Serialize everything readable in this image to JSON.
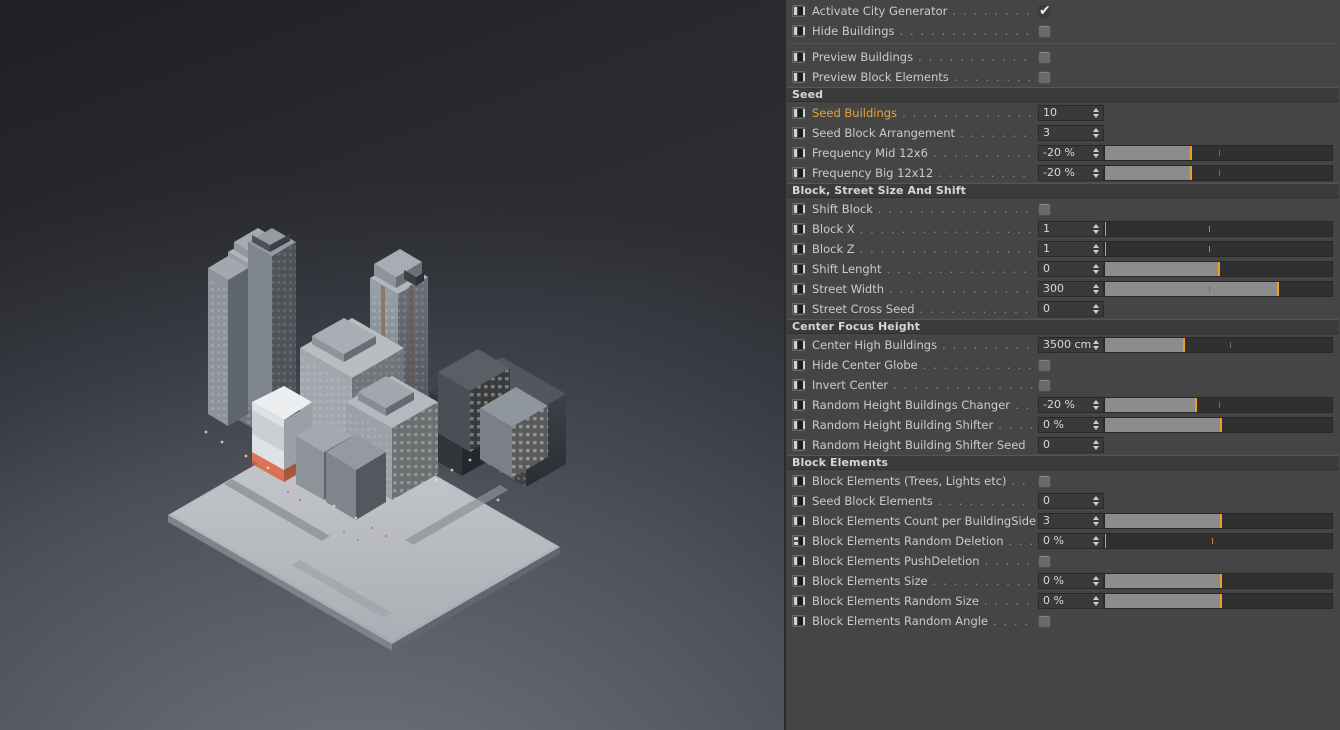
{
  "app": {
    "theme_bg": "#454545",
    "accent": "#f0a020",
    "highlight_text": "#e8a33d"
  },
  "viewport": {
    "name": "3d-viewport",
    "scene": "isometric city block with skyscrapers"
  },
  "panel": {
    "groups": [
      {
        "header": null,
        "rows": [
          {
            "label": "Activate City Generator",
            "dots": ". . . . . . . . . . . . . .",
            "type": "checkbox",
            "checked": true,
            "highlight": false,
            "icon": "port-icon"
          },
          {
            "label": "Hide Buildings",
            "dots": ". . . . . . . . . . . . . . . . . . .",
            "type": "checkbox",
            "checked": false,
            "highlight": false,
            "icon": "port-icon"
          }
        ]
      },
      {
        "header": null,
        "divider": true,
        "rows": [
          {
            "label": "Preview Buildings",
            "dots": ". . . . . . . . . . . . . . . . .",
            "type": "checkbox",
            "checked": false,
            "highlight": false,
            "icon": "port-icon"
          },
          {
            "label": "Preview Block Elements",
            "dots": ". . . . . . . . . . . .",
            "type": "checkbox",
            "checked": false,
            "highlight": false,
            "icon": "port-icon"
          }
        ]
      },
      {
        "header": "Seed",
        "rows": [
          {
            "label": "Seed Buildings",
            "dots": ". . . . . . . . . . . . . . . . . . .",
            "type": "number",
            "value": "10",
            "highlight": true,
            "icon": "port-icon"
          },
          {
            "label": "Seed Block Arrangement",
            "dots": ". . . . . . . . . . . . .",
            "type": "number",
            "value": "3",
            "highlight": false,
            "icon": "port-icon"
          },
          {
            "label": "Frequency Mid 12x6",
            "dots": ". . . . . . . . . . . . . . .",
            "type": "slider",
            "value": "-20 %",
            "fill": 38,
            "knob": 38,
            "tick": 50,
            "highlight": false,
            "icon": "port-icon"
          },
          {
            "label": "Frequency Big 12x12",
            "dots": ". . . . . . . . . . . . . .",
            "type": "slider",
            "value": "-20 %",
            "fill": 38,
            "knob": 38,
            "tick": 50,
            "highlight": false,
            "icon": "port-icon"
          }
        ]
      },
      {
        "header": "Block, Street Size And Shift",
        "rows": [
          {
            "label": "Shift Block",
            "dots": ". . . . . . . . . . . . . . . . . . . . .",
            "type": "checkbox",
            "checked": false,
            "highlight": false,
            "icon": "port-icon"
          },
          {
            "label": "Block X",
            "dots": ". . . . . . . . . . . . . . . . . . . . . . . .",
            "type": "slider",
            "value": "1",
            "fill": 0,
            "knob": 0,
            "tick": 46,
            "highlight": false,
            "icon": "port-icon"
          },
          {
            "label": "Block Z",
            "dots": ". . . . . . . . . . . . . . . . . . . . . . . .",
            "type": "slider",
            "value": "1",
            "fill": 0,
            "knob": 0,
            "tick": 46,
            "highlight": false,
            "icon": "port-icon"
          },
          {
            "label": "Shift Lenght",
            "dots": ". . . . . . . . . . . . . . . . . . . .",
            "type": "slider",
            "value": "0",
            "fill": 50,
            "knob": 50,
            "tick": -1,
            "highlight": false,
            "icon": "port-icon"
          },
          {
            "label": "Street Width",
            "dots": ". . . . . . . . . . . . . . . . . . . .",
            "type": "slider",
            "value": "300",
            "fill": 76,
            "knob": 76,
            "tick": 46,
            "highlight": false,
            "icon": "port-icon"
          },
          {
            "label": "Street Cross Seed",
            "dots": ". . . . . . . . . . . . . . . . .",
            "type": "number",
            "value": "0",
            "highlight": false,
            "icon": "port-icon"
          }
        ]
      },
      {
        "header": "Center Focus Height",
        "rows": [
          {
            "label": "Center High Buildings",
            "dots": ". . . . . . . . . . . . . .",
            "type": "slider",
            "value": "3500 cm",
            "fill": 35,
            "knob": 35,
            "tick": 55,
            "highlight": false,
            "icon": "port-icon"
          },
          {
            "label": "Hide Center Globe",
            "dots": ". . . . . . . . . . . . . . . .",
            "type": "checkbox",
            "checked": false,
            "highlight": false,
            "icon": "port-icon"
          },
          {
            "label": "Invert Center",
            "dots": ". . . . . . . . . . . . . . . . . . .",
            "type": "checkbox",
            "checked": false,
            "highlight": false,
            "icon": "port-icon"
          },
          {
            "label": "Random Height Buildings Changer",
            "dots": ". . . .",
            "type": "slider",
            "value": "-20 %",
            "fill": 40,
            "knob": 40,
            "tick": 50,
            "highlight": false,
            "icon": "port-icon"
          },
          {
            "label": "Random Height Building Shifter",
            "dots": ". . . . . .",
            "type": "slider",
            "value": "0 %",
            "fill": 51,
            "knob": 51,
            "tick": -1,
            "highlight": false,
            "icon": "port-icon"
          },
          {
            "label": "Random Height Building Shifter Seed",
            "dots": "",
            "type": "number",
            "value": "0",
            "highlight": false,
            "icon": "port-icon"
          }
        ]
      },
      {
        "header": "Block Elements",
        "rows": [
          {
            "label": "Block Elements (Trees, Lights etc)",
            "dots": ". . . . . .",
            "type": "checkbox",
            "checked": false,
            "highlight": false,
            "icon": "port-icon"
          },
          {
            "label": "Seed Block Elements",
            "dots": ". . . . . . . . . . . . . . .",
            "type": "number",
            "value": "0",
            "highlight": false,
            "icon": "port-icon"
          },
          {
            "label": "Block Elements Count per BuildingSide",
            "dots": "",
            "type": "slider",
            "value": "3",
            "fill": 51,
            "knob": 51,
            "tick": -1,
            "highlight": false,
            "icon": "port-icon"
          },
          {
            "label": "Block Elements Random Deletion",
            "dots": ". . . . .",
            "type": "slider",
            "value": "0 %",
            "fill": 0,
            "knob": 0,
            "tick": 47,
            "highlight": false,
            "icon": "port-icon-alt"
          },
          {
            "label": "Block Elements PushDeletion",
            "dots": ". . . . . . . . .",
            "type": "checkbox",
            "checked": false,
            "highlight": false,
            "icon": "port-icon"
          },
          {
            "label": "Block Elements Size",
            "dots": ". . . . . . . . . . . . . . .",
            "type": "slider",
            "value": "0 %",
            "fill": 51,
            "knob": 51,
            "tick": -1,
            "highlight": false,
            "icon": "port-icon"
          },
          {
            "label": "Block Elements Random Size",
            "dots": ". . . . . . . . . .",
            "type": "slider",
            "value": "0 %",
            "fill": 51,
            "knob": 51,
            "tick": -1,
            "highlight": false,
            "icon": "port-icon"
          },
          {
            "label": "Block Elements Random Angle",
            "dots": ". . . . . . . . .",
            "type": "checkbox",
            "checked": false,
            "highlight": false,
            "icon": "port-icon"
          }
        ]
      }
    ]
  }
}
